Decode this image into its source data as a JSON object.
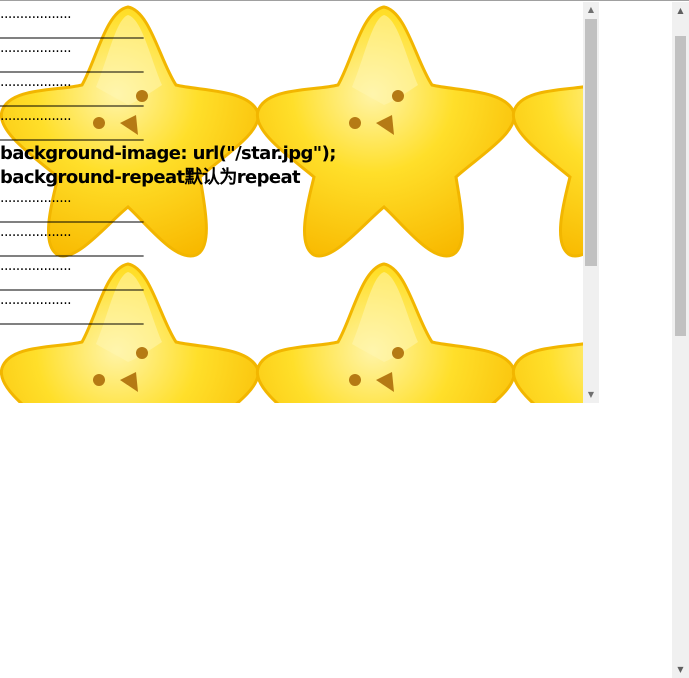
{
  "box": {
    "background_image": "star",
    "lines_top": [
      "..................",
      "______________________",
      "..................",
      "______________________",
      "..................",
      "______________________",
      "..................",
      "______________________"
    ],
    "code_lines": [
      "background-image: url(\"/star.jpg\");",
      "background-repeat默认为repeat"
    ],
    "lines_bottom": [
      "..................",
      "______________________",
      "..................",
      "______________________",
      "..................",
      "______________________",
      "..................",
      "______________________"
    ]
  },
  "scrollbars": {
    "up_arrow": "▲",
    "down_arrow": "▼"
  },
  "colors": {
    "star_main": "#ffd814",
    "star_edge": "#f5b800",
    "star_highlight": "#fff2a0",
    "star_face": "#b07810",
    "scrollbar_track": "#f0f0f0",
    "scrollbar_thumb": "#c1c1c1"
  }
}
